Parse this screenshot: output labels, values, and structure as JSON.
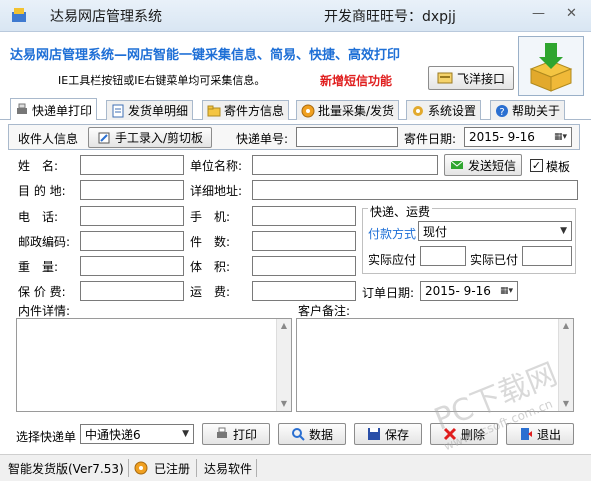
{
  "window": {
    "title": "达易网店管理系统",
    "contact": "开发商旺旺号：dxpjj",
    "minimize": "—",
    "close": "✕"
  },
  "banner": {
    "slogan": "达易网店管理系统—网店智能一键采集信息、简易、快捷、高效打印",
    "tip": "IE工具栏按钮或IE右键菜单均可采集信息。",
    "new_feature": "新增短信功能",
    "feixiang_label": "飞洋接口"
  },
  "tabs": [
    {
      "label": "快递单打印",
      "icon": "print-icon"
    },
    {
      "label": "发货单明细",
      "icon": "document-icon"
    },
    {
      "label": "寄件方信息",
      "icon": "folder-icon"
    },
    {
      "label": "批量采集/发货",
      "icon": "gear-orange-icon"
    },
    {
      "label": "系统设置",
      "icon": "settings-icon"
    },
    {
      "label": "帮助关于",
      "icon": "help-icon"
    }
  ],
  "subbar": {
    "receiver_info": "收件人信息",
    "manual_entry": "手工录入/剪切板",
    "tracking_label": "快递单号:",
    "tracking_value": "",
    "send_date_label": "寄件日期:",
    "send_date_value": "2015- 9-16"
  },
  "form": {
    "name_label": "姓　名:",
    "company_label": "单位名称:",
    "send_sms": "发送短信",
    "template_label": "模板",
    "destination_label": "目 的 地:",
    "address_label": "详细地址:",
    "phone_label": "电　话:",
    "mobile_label": "手　机:",
    "postcode_label": "邮政编码:",
    "pieces_label": "件　数:",
    "weight_label": "重　量:",
    "volume_label": "体　积:",
    "insured_label": "保 价 费:",
    "freight_label": "运　费:",
    "order_date_label": "订单日期:",
    "order_date_value": "2015- 9-16",
    "detail_label": "内件详情:",
    "remark_label": "客户备注:"
  },
  "shipping": {
    "group_title": "快递、运费",
    "payment_label": "付款方式",
    "payment_value": "现付",
    "should_pay_label": "实际应付",
    "paid_label": "实际已付"
  },
  "bottom": {
    "choose_label": "选择快递单",
    "courier_value": "中通快递6",
    "print": "打印",
    "data": "数据",
    "save": "保存",
    "delete": "删除",
    "exit": "退出"
  },
  "status": {
    "version": "智能发货版(Ver7.53)",
    "registered": "已注册",
    "company": "达易软件"
  },
  "watermark": {
    "main": "PC下载网",
    "url": "www.pcsoft.com.cn"
  },
  "colors": {
    "slogan": "#1e6fd6",
    "new_feature": "#e01e1e"
  }
}
